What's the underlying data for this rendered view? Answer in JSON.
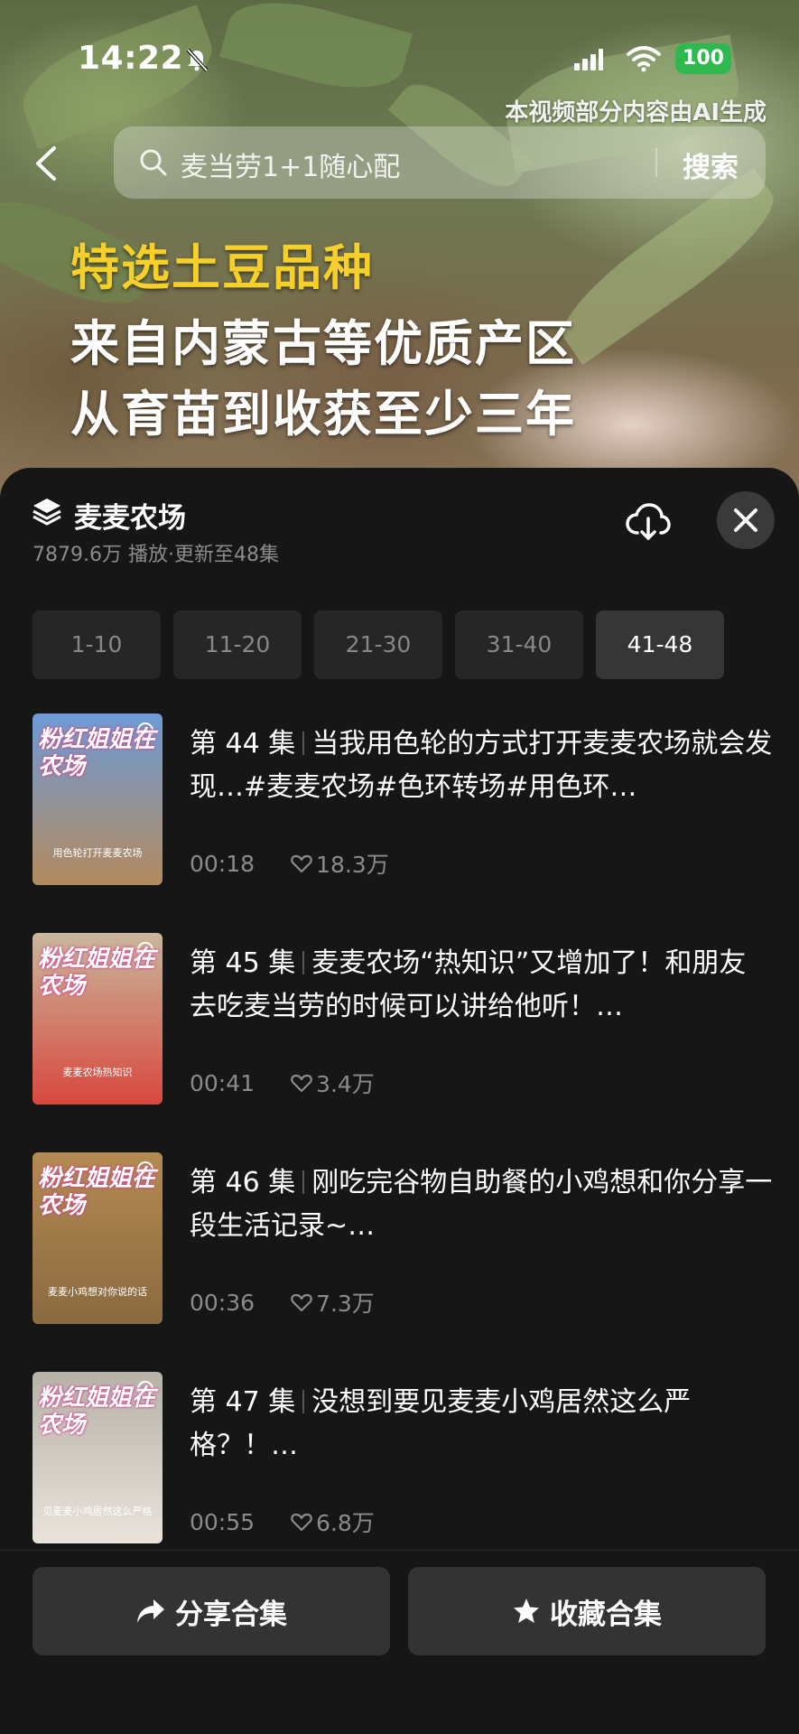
{
  "status_bar": {
    "time": "14:22",
    "battery": "100",
    "icons": [
      "bell-muted-icon",
      "signal-icon",
      "wifi-icon",
      "battery-icon"
    ]
  },
  "video": {
    "ai_notice": "本视频部分内容由AI生成",
    "captions": [
      "特选土豆品种",
      "来自内蒙古等优质产区",
      "从育苗到收获至少三年"
    ]
  },
  "search": {
    "query": "麦当劳1+1随心配",
    "button_label": "搜索"
  },
  "collection": {
    "title": "麦麦农场",
    "meta": "7879.6万 播放·更新至48集",
    "range_tabs": [
      {
        "label": "1-10",
        "active": false
      },
      {
        "label": "11-20",
        "active": false
      },
      {
        "label": "21-30",
        "active": false
      },
      {
        "label": "31-40",
        "active": false
      },
      {
        "label": "41-48",
        "active": true
      }
    ]
  },
  "episodes": [
    {
      "number": "第 44 集",
      "title": "当我用色轮的方式打开麦麦农场就会发现…#麦麦农场#色环转场#用色环…",
      "duration": "00:18",
      "likes": "18.3万",
      "thumb_title": "粉红姐姐在农场",
      "thumb_sub": "用色轮打开麦麦农场",
      "thumb_colors": [
        "#6d9bd6",
        "#b38a5e"
      ]
    },
    {
      "number": "第 45 集",
      "title": "麦麦农场“热知识”又增加了！和朋友去吃麦当劳的时候可以讲给他听！…",
      "duration": "00:41",
      "likes": "3.4万",
      "thumb_title": "粉红姐姐在农场",
      "thumb_sub": "麦麦农场热知识",
      "thumb_colors": [
        "#c9b79c",
        "#d8483f"
      ]
    },
    {
      "number": "第 46 集",
      "title": "刚吃完谷物自助餐的小鸡想和你分享一段生活记录~…",
      "duration": "00:36",
      "likes": "7.3万",
      "thumb_title": "粉红姐姐在农场",
      "thumb_sub": "麦麦小鸡想对你说的话",
      "thumb_colors": [
        "#b48a52",
        "#8a6a40"
      ]
    },
    {
      "number": "第 47 集",
      "title": "没想到要见麦麦小鸡居然这么严格？！…",
      "duration": "00:55",
      "likes": "6.8万",
      "thumb_title": "粉红姐姐在农场",
      "thumb_sub": "见麦麦小鸡居然这么严格",
      "thumb_colors": [
        "#b7b2a8",
        "#e9e3dc"
      ]
    }
  ],
  "actions": {
    "share_label": "分享合集",
    "favorite_label": "收藏合集"
  }
}
